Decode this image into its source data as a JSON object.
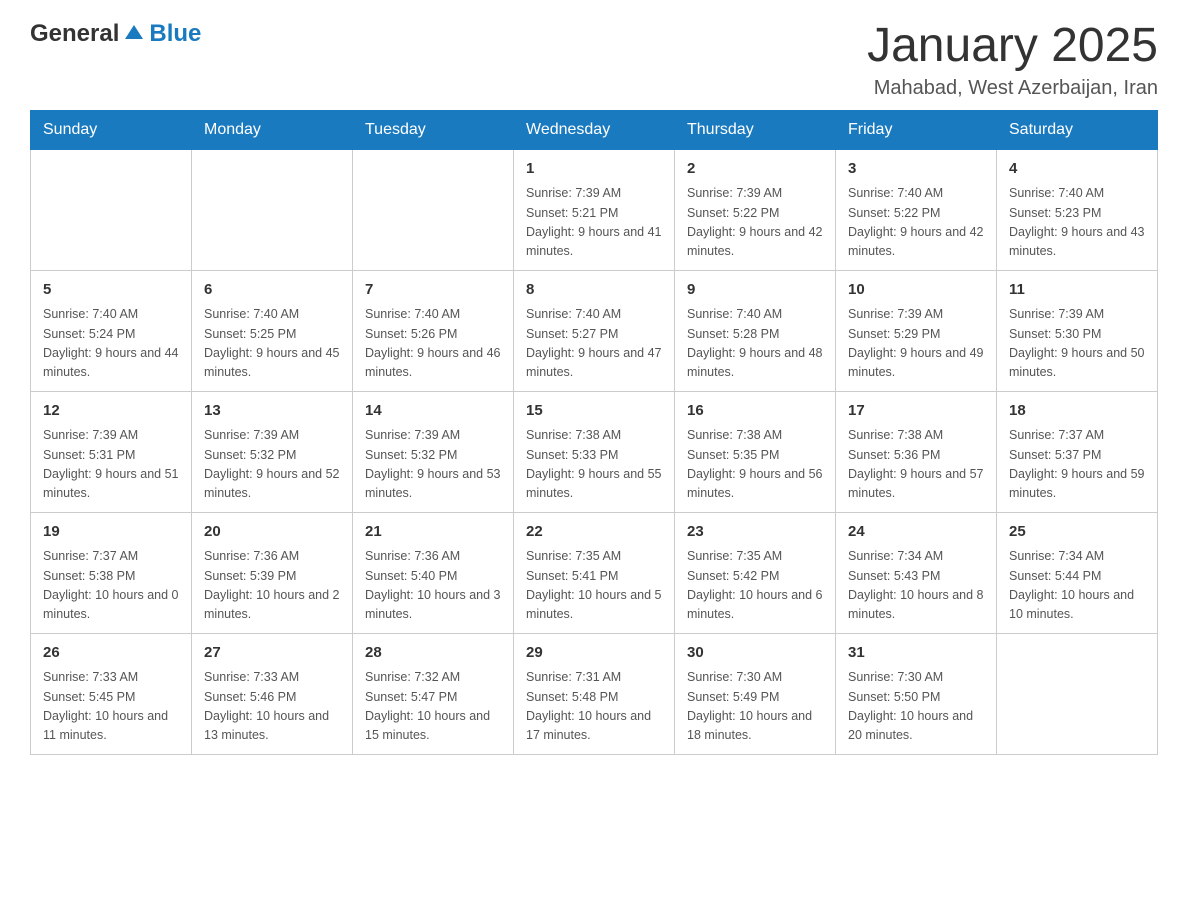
{
  "logo": {
    "general": "General",
    "blue": "Blue"
  },
  "header": {
    "title": "January 2025",
    "subtitle": "Mahabad, West Azerbaijan, Iran"
  },
  "weekdays": [
    "Sunday",
    "Monday",
    "Tuesday",
    "Wednesday",
    "Thursday",
    "Friday",
    "Saturday"
  ],
  "weeks": [
    [
      {
        "day": "",
        "info": ""
      },
      {
        "day": "",
        "info": ""
      },
      {
        "day": "",
        "info": ""
      },
      {
        "day": "1",
        "info": "Sunrise: 7:39 AM\nSunset: 5:21 PM\nDaylight: 9 hours and 41 minutes."
      },
      {
        "day": "2",
        "info": "Sunrise: 7:39 AM\nSunset: 5:22 PM\nDaylight: 9 hours and 42 minutes."
      },
      {
        "day": "3",
        "info": "Sunrise: 7:40 AM\nSunset: 5:22 PM\nDaylight: 9 hours and 42 minutes."
      },
      {
        "day": "4",
        "info": "Sunrise: 7:40 AM\nSunset: 5:23 PM\nDaylight: 9 hours and 43 minutes."
      }
    ],
    [
      {
        "day": "5",
        "info": "Sunrise: 7:40 AM\nSunset: 5:24 PM\nDaylight: 9 hours and 44 minutes."
      },
      {
        "day": "6",
        "info": "Sunrise: 7:40 AM\nSunset: 5:25 PM\nDaylight: 9 hours and 45 minutes."
      },
      {
        "day": "7",
        "info": "Sunrise: 7:40 AM\nSunset: 5:26 PM\nDaylight: 9 hours and 46 minutes."
      },
      {
        "day": "8",
        "info": "Sunrise: 7:40 AM\nSunset: 5:27 PM\nDaylight: 9 hours and 47 minutes."
      },
      {
        "day": "9",
        "info": "Sunrise: 7:40 AM\nSunset: 5:28 PM\nDaylight: 9 hours and 48 minutes."
      },
      {
        "day": "10",
        "info": "Sunrise: 7:39 AM\nSunset: 5:29 PM\nDaylight: 9 hours and 49 minutes."
      },
      {
        "day": "11",
        "info": "Sunrise: 7:39 AM\nSunset: 5:30 PM\nDaylight: 9 hours and 50 minutes."
      }
    ],
    [
      {
        "day": "12",
        "info": "Sunrise: 7:39 AM\nSunset: 5:31 PM\nDaylight: 9 hours and 51 minutes."
      },
      {
        "day": "13",
        "info": "Sunrise: 7:39 AM\nSunset: 5:32 PM\nDaylight: 9 hours and 52 minutes."
      },
      {
        "day": "14",
        "info": "Sunrise: 7:39 AM\nSunset: 5:32 PM\nDaylight: 9 hours and 53 minutes."
      },
      {
        "day": "15",
        "info": "Sunrise: 7:38 AM\nSunset: 5:33 PM\nDaylight: 9 hours and 55 minutes."
      },
      {
        "day": "16",
        "info": "Sunrise: 7:38 AM\nSunset: 5:35 PM\nDaylight: 9 hours and 56 minutes."
      },
      {
        "day": "17",
        "info": "Sunrise: 7:38 AM\nSunset: 5:36 PM\nDaylight: 9 hours and 57 minutes."
      },
      {
        "day": "18",
        "info": "Sunrise: 7:37 AM\nSunset: 5:37 PM\nDaylight: 9 hours and 59 minutes."
      }
    ],
    [
      {
        "day": "19",
        "info": "Sunrise: 7:37 AM\nSunset: 5:38 PM\nDaylight: 10 hours and 0 minutes."
      },
      {
        "day": "20",
        "info": "Sunrise: 7:36 AM\nSunset: 5:39 PM\nDaylight: 10 hours and 2 minutes."
      },
      {
        "day": "21",
        "info": "Sunrise: 7:36 AM\nSunset: 5:40 PM\nDaylight: 10 hours and 3 minutes."
      },
      {
        "day": "22",
        "info": "Sunrise: 7:35 AM\nSunset: 5:41 PM\nDaylight: 10 hours and 5 minutes."
      },
      {
        "day": "23",
        "info": "Sunrise: 7:35 AM\nSunset: 5:42 PM\nDaylight: 10 hours and 6 minutes."
      },
      {
        "day": "24",
        "info": "Sunrise: 7:34 AM\nSunset: 5:43 PM\nDaylight: 10 hours and 8 minutes."
      },
      {
        "day": "25",
        "info": "Sunrise: 7:34 AM\nSunset: 5:44 PM\nDaylight: 10 hours and 10 minutes."
      }
    ],
    [
      {
        "day": "26",
        "info": "Sunrise: 7:33 AM\nSunset: 5:45 PM\nDaylight: 10 hours and 11 minutes."
      },
      {
        "day": "27",
        "info": "Sunrise: 7:33 AM\nSunset: 5:46 PM\nDaylight: 10 hours and 13 minutes."
      },
      {
        "day": "28",
        "info": "Sunrise: 7:32 AM\nSunset: 5:47 PM\nDaylight: 10 hours and 15 minutes."
      },
      {
        "day": "29",
        "info": "Sunrise: 7:31 AM\nSunset: 5:48 PM\nDaylight: 10 hours and 17 minutes."
      },
      {
        "day": "30",
        "info": "Sunrise: 7:30 AM\nSunset: 5:49 PM\nDaylight: 10 hours and 18 minutes."
      },
      {
        "day": "31",
        "info": "Sunrise: 7:30 AM\nSunset: 5:50 PM\nDaylight: 10 hours and 20 minutes."
      },
      {
        "day": "",
        "info": ""
      }
    ]
  ]
}
